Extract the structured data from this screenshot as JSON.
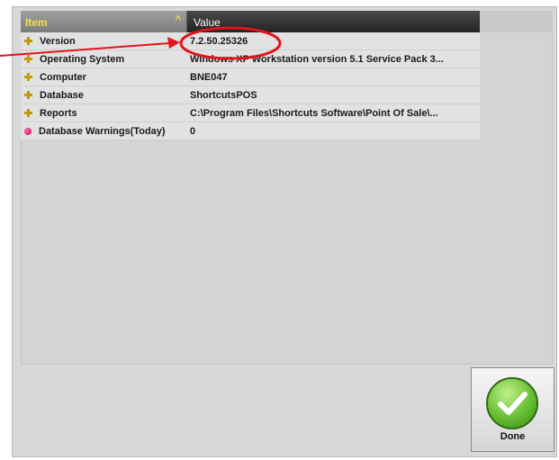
{
  "grid": {
    "header": {
      "item_label": "Item",
      "value_label": "Value",
      "sort_icon": "sort-ascending-caret"
    },
    "rows": [
      {
        "item": "Version",
        "value": "7.2.50.25326",
        "icon": "plus-icon"
      },
      {
        "item": "Operating System",
        "value": "Windows XP Workstation version 5.1 Service Pack 3...",
        "icon": "plus-icon"
      },
      {
        "item": "Computer",
        "value": "BNE047",
        "icon": "plus-icon"
      },
      {
        "item": "Database",
        "value": "ShortcutsPOS",
        "icon": "plus-icon"
      },
      {
        "item": "Reports",
        "value": "C:\\Program Files\\Shortcuts Software\\Point Of Sale\\...",
        "icon": "plus-icon"
      },
      {
        "item": "Database Warnings(Today)",
        "value": "0",
        "icon": "warning-dot-icon"
      }
    ]
  },
  "done_button": {
    "label": "Done",
    "icon": "checkmark-icon"
  },
  "colors": {
    "header_item_text": "#f2e24a",
    "annotation_red": "#e0141e",
    "check_green": "#5fb92c",
    "warning_dot": "#c3004e",
    "plus_icon": "#c79a00"
  }
}
